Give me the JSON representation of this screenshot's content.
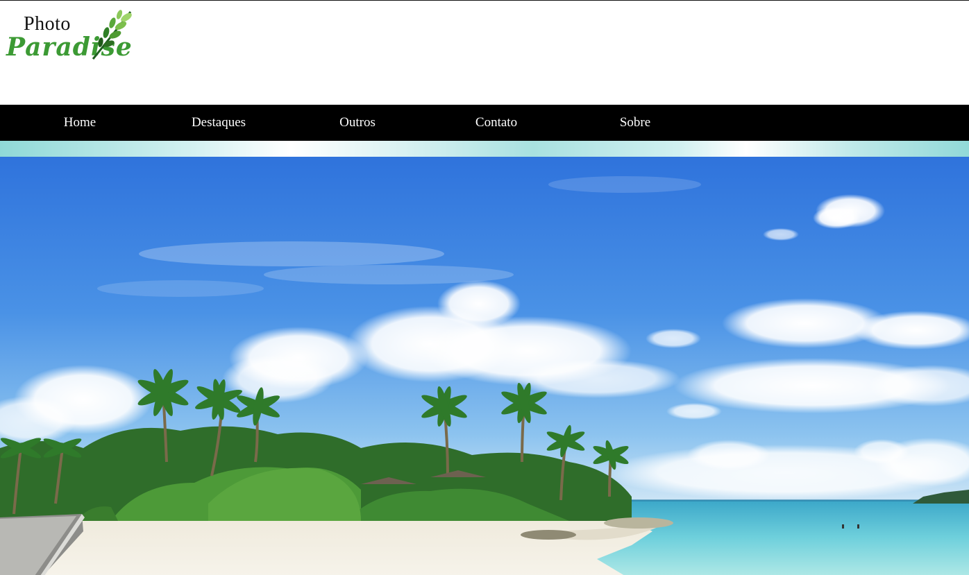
{
  "logo": {
    "line1": "Photo",
    "line2": "Paradise",
    "icon": "leaf-icon"
  },
  "nav": {
    "items": [
      {
        "label": "Home"
      },
      {
        "label": "Destaques"
      },
      {
        "label": "Outros"
      },
      {
        "label": "Contato"
      },
      {
        "label": "Sobre"
      }
    ]
  },
  "hero": {
    "subject": "tropical-beach-photo"
  },
  "colors": {
    "nav_background": "#000000",
    "nav_text": "#ffffff",
    "logo_green": "#3c9a34",
    "stripe_teal": "#8fd9d7",
    "sky_blue": "#3f86e0"
  }
}
